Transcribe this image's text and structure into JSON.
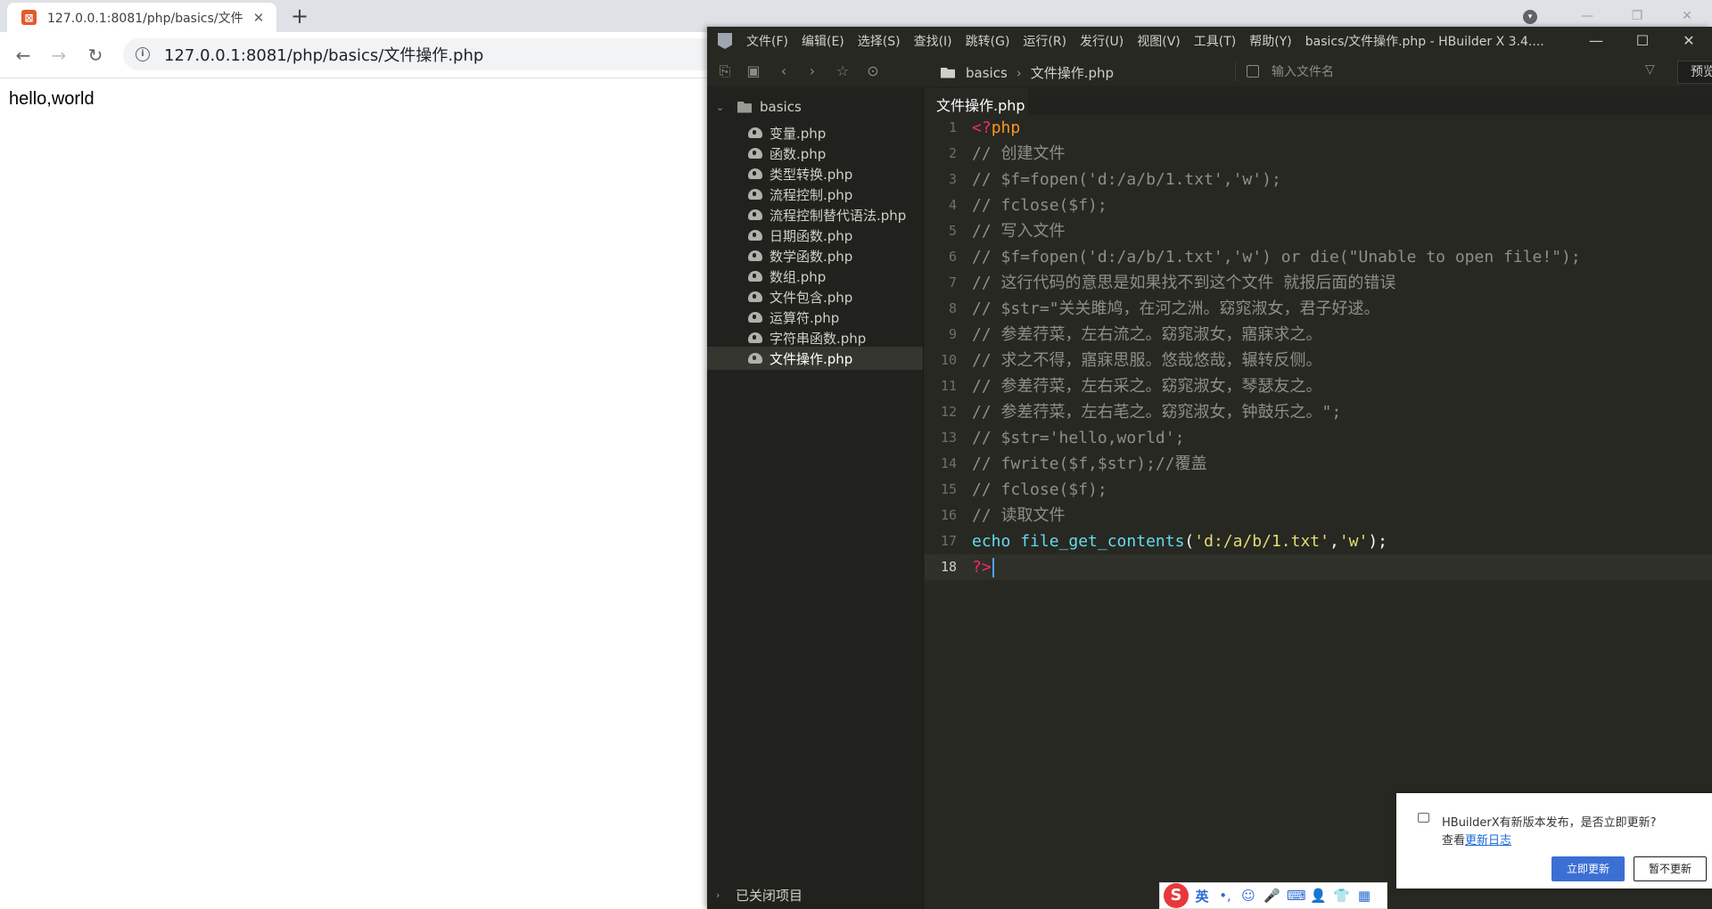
{
  "browser": {
    "tab_title": "127.0.0.1:8081/php/basics/文件",
    "tab_close": "✕",
    "new_tab": "+",
    "url": "127.0.0.1:8081/php/basics/文件操作.php",
    "page_text": "hello,world"
  },
  "hbuilder": {
    "menu": [
      "文件(F)",
      "编辑(E)",
      "选择(S)",
      "查找(I)",
      "跳转(G)",
      "运行(R)",
      "发行(U)",
      "视图(V)",
      "工具(T)",
      "帮助(Y)"
    ],
    "title": "basics/文件操作.php - HBuilder X 3.4....",
    "breadcrumb": {
      "folder": "basics",
      "separator": "›",
      "file": "文件操作.php"
    },
    "file_search_placeholder": "输入文件名",
    "preview_label": "预览",
    "project": {
      "name": "basics",
      "files": [
        "变量.php",
        "函数.php",
        "类型转换.php",
        "流程控制.php",
        "流程控制替代语法.php",
        "日期函数.php",
        "数学函数.php",
        "数组.php",
        "文件包含.php",
        "运算符.php",
        "字符串函数.php",
        "文件操作.php"
      ],
      "active_file": "文件操作.php"
    },
    "closed_projects_label": "已关闭项目",
    "editor_tab": "文件操作.php",
    "code_lines": [
      {
        "n": "1",
        "segments": [
          {
            "t": "<?",
            "c": "tag"
          },
          {
            "t": "php",
            "c": "php"
          }
        ]
      },
      {
        "n": "2",
        "segments": [
          {
            "t": "// 创建文件",
            "c": "comment"
          }
        ]
      },
      {
        "n": "3",
        "segments": [
          {
            "t": "// $f=fopen('d:/a/b/1.txt','w');",
            "c": "comment"
          }
        ]
      },
      {
        "n": "4",
        "segments": [
          {
            "t": "// fclose($f);",
            "c": "comment"
          }
        ]
      },
      {
        "n": "5",
        "segments": [
          {
            "t": "// 写入文件",
            "c": "comment"
          }
        ]
      },
      {
        "n": "6",
        "segments": [
          {
            "t": "// $f=fopen('d:/a/b/1.txt','w') or die(\"Unable to open file!\");",
            "c": "comment"
          }
        ]
      },
      {
        "n": "7",
        "segments": [
          {
            "t": "// 这行代码的意思是如果找不到这个文件 就报后面的错误",
            "c": "comment"
          }
        ]
      },
      {
        "n": "8",
        "segments": [
          {
            "t": "// $str=\"关关雎鸠，在河之洲。窈窕淑女，君子好逑。",
            "c": "comment"
          }
        ]
      },
      {
        "n": "9",
        "segments": [
          {
            "t": "// 参差荇菜，左右流之。窈窕淑女，寤寐求之。",
            "c": "comment"
          }
        ]
      },
      {
        "n": "10",
        "segments": [
          {
            "t": "// 求之不得，寤寐思服。悠哉悠哉，辗转反侧。",
            "c": "comment"
          }
        ]
      },
      {
        "n": "11",
        "segments": [
          {
            "t": "// 参差荇菜，左右采之。窈窕淑女，琴瑟友之。",
            "c": "comment"
          }
        ]
      },
      {
        "n": "12",
        "segments": [
          {
            "t": "// 参差荇菜，左右芼之。窈窕淑女，钟鼓乐之。\";",
            "c": "comment"
          }
        ]
      },
      {
        "n": "13",
        "segments": [
          {
            "t": "// $str='hello,world';",
            "c": "comment"
          }
        ]
      },
      {
        "n": "14",
        "segments": [
          {
            "t": "// fwrite($f,$str);//覆盖",
            "c": "comment"
          }
        ]
      },
      {
        "n": "15",
        "segments": [
          {
            "t": "// fclose($f);",
            "c": "comment"
          }
        ]
      },
      {
        "n": "16",
        "segments": [
          {
            "t": "// 读取文件",
            "c": "comment"
          }
        ]
      },
      {
        "n": "17",
        "segments": [
          {
            "t": "echo ",
            "c": "kw"
          },
          {
            "t": "file_get_contents",
            "c": "kw"
          },
          {
            "t": "(",
            "c": "plain"
          },
          {
            "t": "'d:/a/b/1.txt'",
            "c": "str"
          },
          {
            "t": ",",
            "c": "plain"
          },
          {
            "t": "'w'",
            "c": "str"
          },
          {
            "t": ");",
            "c": "plain"
          }
        ]
      },
      {
        "n": "18",
        "segments": [
          {
            "t": "?>",
            "c": "tag"
          }
        ],
        "current": true
      }
    ]
  },
  "notification": {
    "title": "HBuilderX有新版本发布，是否立即更新?",
    "sub_prefix": "查看",
    "link": "更新日志",
    "update_button": "立即更新",
    "skip_button": "暂不更新"
  },
  "ime": {
    "logo": "S",
    "lang": "英",
    "items": [
      "•,",
      "☺",
      "🎤",
      "⌨",
      "👤",
      "👕",
      "▦"
    ]
  },
  "colors": {
    "editor_bg": "#272822",
    "sidebar_bg": "#21221d",
    "comment": "#8e8f88",
    "keyword": "#66d9ef",
    "string": "#e6db74",
    "tag": "#f92672",
    "accent_blue": "#3b6fd3"
  }
}
